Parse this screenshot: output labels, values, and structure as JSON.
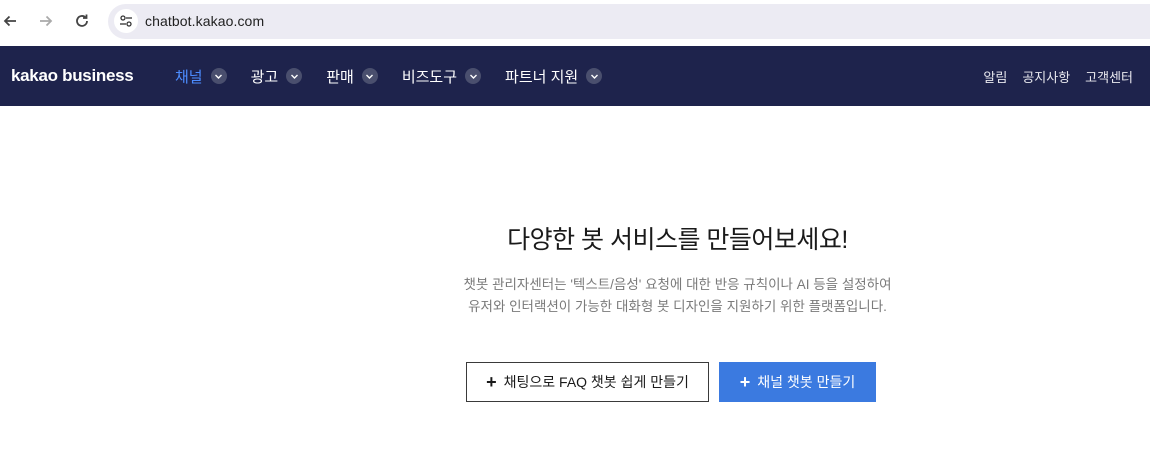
{
  "browser": {
    "url": "chatbot.kakao.com"
  },
  "header": {
    "logo": "kakao business",
    "menu": [
      {
        "label": "채널",
        "active": true
      },
      {
        "label": "광고",
        "active": false
      },
      {
        "label": "판매",
        "active": false
      },
      {
        "label": "비즈도구",
        "active": false
      },
      {
        "label": "파트너 지원",
        "active": false
      }
    ],
    "utility": {
      "alerts": "알림",
      "notice": "공지사항",
      "support": "고객센터"
    }
  },
  "hero": {
    "title": "다양한 봇 서비스를 만들어보세요!",
    "desc_line1": "챗봇 관리자센터는 '텍스트/음성' 요청에 대한 반응 규칙이나 AI 등을 설정하여",
    "desc_line2": "유저와 인터랙션이 가능한 대화형 봇 디자인을 지원하기 위한 플랫폼입니다.",
    "faq_button": "채팅으로 FAQ 챗봇 쉽게 만들기",
    "channel_button": "채널 챗봇 만들기"
  },
  "colors": {
    "nav_bg": "#1e234c",
    "active_menu": "#4c8cff",
    "primary_button": "#3b7ae0"
  }
}
